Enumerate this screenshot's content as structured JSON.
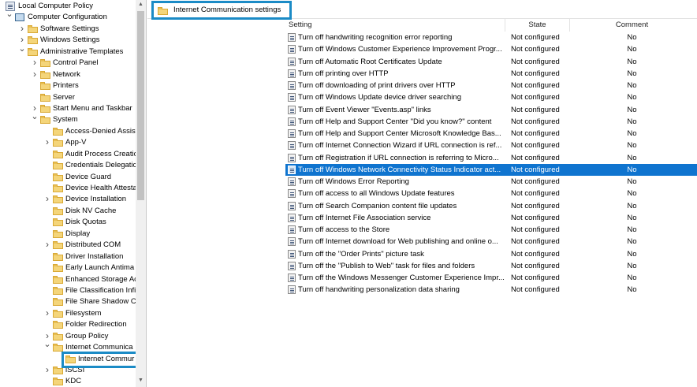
{
  "tree": {
    "items": [
      {
        "label": "Local Computer Policy",
        "level": 0,
        "expander": "",
        "icon": "policy"
      },
      {
        "label": "Computer Configuration",
        "level": 1,
        "expander": "open",
        "icon": "computer"
      },
      {
        "label": "Software Settings",
        "level": 2,
        "expander": "closed",
        "icon": "folder"
      },
      {
        "label": "Windows Settings",
        "level": 2,
        "expander": "closed",
        "icon": "folder"
      },
      {
        "label": "Administrative Templates",
        "level": 2,
        "expander": "open",
        "icon": "folder"
      },
      {
        "label": "Control Panel",
        "level": 3,
        "expander": "closed",
        "icon": "folder"
      },
      {
        "label": "Network",
        "level": 3,
        "expander": "closed",
        "icon": "folder"
      },
      {
        "label": "Printers",
        "level": 3,
        "expander": "",
        "icon": "folder"
      },
      {
        "label": "Server",
        "level": 3,
        "expander": "",
        "icon": "folder"
      },
      {
        "label": "Start Menu and Taskbar",
        "level": 3,
        "expander": "closed",
        "icon": "folder"
      },
      {
        "label": "System",
        "level": 3,
        "expander": "open",
        "icon": "folder"
      },
      {
        "label": "Access-Denied Assist",
        "level": 4,
        "expander": "",
        "icon": "folder"
      },
      {
        "label": "App-V",
        "level": 4,
        "expander": "closed",
        "icon": "folder"
      },
      {
        "label": "Audit Process Creatic",
        "level": 4,
        "expander": "",
        "icon": "folder"
      },
      {
        "label": "Credentials Delegatic",
        "level": 4,
        "expander": "",
        "icon": "folder"
      },
      {
        "label": "Device Guard",
        "level": 4,
        "expander": "",
        "icon": "folder"
      },
      {
        "label": "Device Health Attesta",
        "level": 4,
        "expander": "",
        "icon": "folder"
      },
      {
        "label": "Device Installation",
        "level": 4,
        "expander": "closed",
        "icon": "folder"
      },
      {
        "label": "Disk NV Cache",
        "level": 4,
        "expander": "",
        "icon": "folder"
      },
      {
        "label": "Disk Quotas",
        "level": 4,
        "expander": "",
        "icon": "folder"
      },
      {
        "label": "Display",
        "level": 4,
        "expander": "",
        "icon": "folder"
      },
      {
        "label": "Distributed COM",
        "level": 4,
        "expander": "closed",
        "icon": "folder"
      },
      {
        "label": "Driver Installation",
        "level": 4,
        "expander": "",
        "icon": "folder"
      },
      {
        "label": "Early Launch Antima",
        "level": 4,
        "expander": "",
        "icon": "folder"
      },
      {
        "label": "Enhanced Storage Ac",
        "level": 4,
        "expander": "",
        "icon": "folder"
      },
      {
        "label": "File Classification Infi",
        "level": 4,
        "expander": "",
        "icon": "folder"
      },
      {
        "label": "File Share Shadow Cc",
        "level": 4,
        "expander": "",
        "icon": "folder"
      },
      {
        "label": "Filesystem",
        "level": 4,
        "expander": "closed",
        "icon": "folder"
      },
      {
        "label": "Folder Redirection",
        "level": 4,
        "expander": "",
        "icon": "folder"
      },
      {
        "label": "Group Policy",
        "level": 4,
        "expander": "closed",
        "icon": "folder"
      },
      {
        "label": "Internet Communica",
        "level": 4,
        "expander": "open",
        "icon": "folder"
      },
      {
        "label": "Internet Commur",
        "level": 5,
        "expander": "",
        "icon": "folder",
        "selected": true
      },
      {
        "label": "iSCSI",
        "level": 4,
        "expander": "closed",
        "icon": "folder"
      },
      {
        "label": "KDC",
        "level": 4,
        "expander": "",
        "icon": "folder"
      }
    ]
  },
  "header": {
    "title": "Internet Communication settings"
  },
  "table": {
    "columns": {
      "setting": "Setting",
      "state": "State",
      "comment": "Comment"
    },
    "rows": [
      {
        "setting": "Turn off handwriting recognition error reporting",
        "state": "Not configured",
        "comment": "No"
      },
      {
        "setting": "Turn off Windows Customer Experience Improvement Progr...",
        "state": "Not configured",
        "comment": "No"
      },
      {
        "setting": "Turn off Automatic Root Certificates Update",
        "state": "Not configured",
        "comment": "No"
      },
      {
        "setting": "Turn off printing over HTTP",
        "state": "Not configured",
        "comment": "No"
      },
      {
        "setting": "Turn off downloading of print drivers over HTTP",
        "state": "Not configured",
        "comment": "No"
      },
      {
        "setting": "Turn off Windows Update device driver searching",
        "state": "Not configured",
        "comment": "No"
      },
      {
        "setting": "Turn off Event Viewer \"Events.asp\" links",
        "state": "Not configured",
        "comment": "No"
      },
      {
        "setting": "Turn off Help and Support Center \"Did you know?\" content",
        "state": "Not configured",
        "comment": "No"
      },
      {
        "setting": "Turn off Help and Support Center Microsoft Knowledge Bas...",
        "state": "Not configured",
        "comment": "No"
      },
      {
        "setting": "Turn off Internet Connection Wizard if URL connection is ref...",
        "state": "Not configured",
        "comment": "No"
      },
      {
        "setting": "Turn off Registration if URL connection is referring to Micro...",
        "state": "Not configured",
        "comment": "No"
      },
      {
        "setting": "Turn off Windows Network Connectivity Status Indicator act...",
        "state": "Not configured",
        "comment": "No",
        "selected": true
      },
      {
        "setting": "Turn off Windows Error Reporting",
        "state": "Not configured",
        "comment": "No"
      },
      {
        "setting": "Turn off access to all Windows Update features",
        "state": "Not configured",
        "comment": "No"
      },
      {
        "setting": "Turn off Search Companion content file updates",
        "state": "Not configured",
        "comment": "No"
      },
      {
        "setting": "Turn off Internet File Association service",
        "state": "Not configured",
        "comment": "No"
      },
      {
        "setting": "Turn off access to the Store",
        "state": "Not configured",
        "comment": "No"
      },
      {
        "setting": "Turn off Internet download for Web publishing and online o...",
        "state": "Not configured",
        "comment": "No"
      },
      {
        "setting": "Turn off the \"Order Prints\" picture task",
        "state": "Not configured",
        "comment": "No"
      },
      {
        "setting": "Turn off the \"Publish to Web\" task for files and folders",
        "state": "Not configured",
        "comment": "No"
      },
      {
        "setting": "Turn off the Windows Messenger Customer Experience Impr...",
        "state": "Not configured",
        "comment": "No"
      },
      {
        "setting": "Turn off handwriting personalization data sharing",
        "state": "Not configured",
        "comment": "No"
      }
    ]
  },
  "colors": {
    "selection": "#0f74cf",
    "highlight_box": "#1b8bc6",
    "folder": "#f4d57a"
  }
}
